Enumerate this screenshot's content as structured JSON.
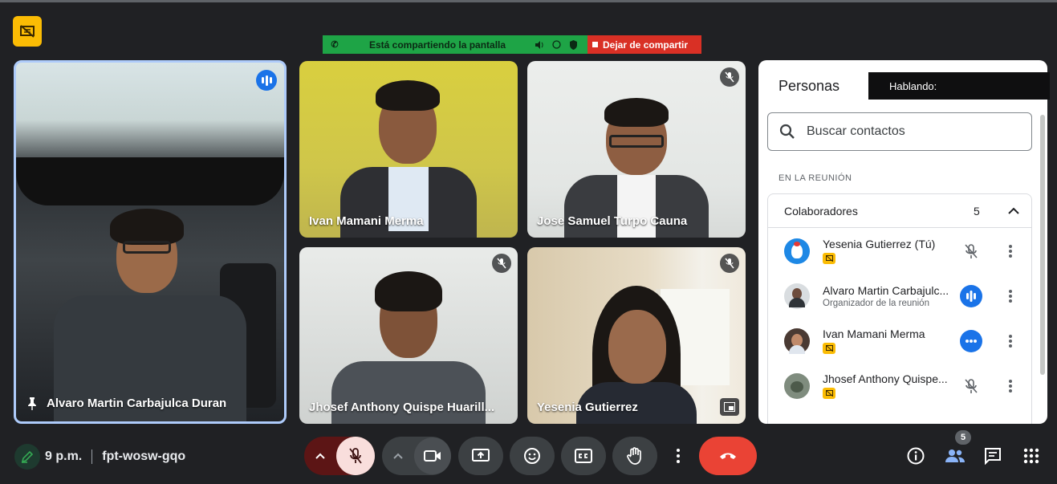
{
  "share_bar": {
    "status_text": "Está compartiendo la pantalla",
    "stop_label": "Dejar de compartir"
  },
  "tiles": {
    "main": {
      "name": "Alvaro Martin Carbajulca Duran"
    },
    "t1": {
      "name": "Ivan Mamani Merma"
    },
    "t2": {
      "name": "Jose Samuel Turpo Cauna"
    },
    "t3": {
      "name": "Jhosef Anthony Quispe Huarill..."
    },
    "t4": {
      "name": "Yesenia Gutierrez"
    }
  },
  "panel": {
    "title": "Personas",
    "tooltip": "Hablando:",
    "search_placeholder": "Buscar contactos",
    "section_label": "EN LA REUNIÓN",
    "group_label": "Colaboradores",
    "group_count": "5",
    "participants": [
      {
        "name": "Yesenia Gutierrez (Tú)",
        "sub": ""
      },
      {
        "name": "Alvaro Martin Carbajulc...",
        "sub": "Organizador de la reunión"
      },
      {
        "name": "Ivan Mamani Merma",
        "sub": ""
      },
      {
        "name": "Jhosef Anthony Quispe...",
        "sub": ""
      }
    ]
  },
  "bottom": {
    "time": "9 p.m.",
    "meeting_code": "fpt-wosw-gqo",
    "people_count": "5"
  },
  "colors": {
    "share_green": "#1ea446",
    "share_red": "#d93025",
    "accent_blue": "#1a73e8",
    "end_call": "#ea4335",
    "present_badge": "#fbbc04"
  }
}
